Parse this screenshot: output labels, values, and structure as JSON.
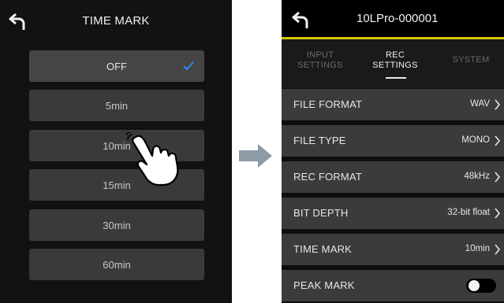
{
  "left": {
    "title": "TIME MARK",
    "options": [
      "OFF",
      "5min",
      "10min",
      "15min",
      "30min",
      "60min"
    ],
    "selected_index": 0
  },
  "right": {
    "device_name": "10LPro-000001",
    "tabs": {
      "input": [
        "INPUT",
        "SETTINGS"
      ],
      "rec": [
        "REC",
        "SETTINGS"
      ],
      "system": "SYSTEM"
    },
    "rows": [
      {
        "label": "FILE FORMAT",
        "value": "WAV"
      },
      {
        "label": "FILE TYPE",
        "value": "MONO"
      },
      {
        "label": "REC FORMAT",
        "value": "48kHz"
      },
      {
        "label": "BIT DEPTH",
        "value": "32-bit float"
      },
      {
        "label": "TIME MARK",
        "value": "10min"
      },
      {
        "label": "PEAK MARK",
        "toggle": "off"
      }
    ]
  },
  "colors": {
    "accent": "#d9c400",
    "check": "#2d8cf0",
    "arrow": "#8e9aa6"
  }
}
